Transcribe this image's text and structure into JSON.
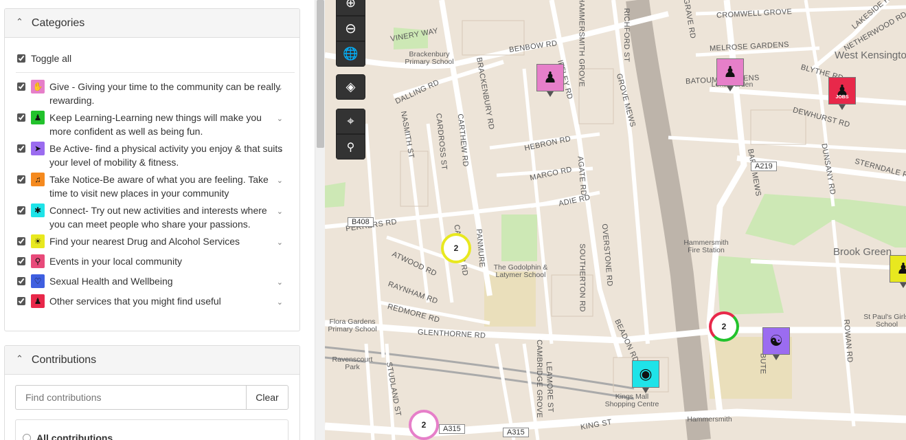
{
  "categories_panel": {
    "title": "Categories",
    "toggle_all_label": "Toggle all",
    "items": [
      {
        "icon": "hands-heart-icon",
        "color": "#e67fc9",
        "label": "Give - Giving your time to the community can be really rewarding.",
        "has_dropdown": true
      },
      {
        "icon": "people-group-icon",
        "color": "#22c22c",
        "label": "Keep Learning-Learning new things will make you more confident as well as being fun.",
        "has_dropdown": true
      },
      {
        "icon": "runner-icon",
        "color": "#9b6cf0",
        "label": "Be Active- find a physical activity you enjoy & that suits your level of mobility & fitness.",
        "has_dropdown": true
      },
      {
        "icon": "megaphone-icon",
        "color": "#f58a1f",
        "label": "Take Notice-Be aware of what you are feeling. Take time to visit new places in your community",
        "has_dropdown": true
      },
      {
        "icon": "puzzle-icon",
        "color": "#1fe3e8",
        "label": "Connect- Try out new activities and interests where you can meet people who share your passions.",
        "has_dropdown": true
      },
      {
        "icon": "sun-icon",
        "color": "#e8e81f",
        "label": "Find your nearest Drug and Alcohol Services",
        "has_dropdown": true
      },
      {
        "icon": "magnifier-icon",
        "color": "#e84a7a",
        "label": "Events in your local community",
        "has_dropdown": false
      },
      {
        "icon": "heart-icon",
        "color": "#3f5fe0",
        "label": "Sexual Health and Wellbeing",
        "has_dropdown": true
      },
      {
        "icon": "people-pair-icon",
        "color": "#e8284a",
        "label": "Other services that you might find useful",
        "has_dropdown": true
      }
    ]
  },
  "contributions_panel": {
    "title": "Contributions",
    "search_placeholder": "Find contributions",
    "clear_label": "Clear",
    "filter_label": "All contributions"
  },
  "map": {
    "street_labels": [
      "CROMWELL GROVE",
      "MELROSE GARDENS",
      "BATOUM GARDENS",
      "BLYTHE RD",
      "DEWHURST RD",
      "NETHERWOOD RD",
      "LAKESIDE RD",
      "BENBOW RD",
      "HAMMERSMITH GROVE",
      "RICHFORD ST",
      "DALLING RD",
      "BRACKENBURY RD",
      "IFFLEY RD",
      "HEBRON RD",
      "MARCO RD",
      "ADIE RD",
      "AGATE RD",
      "GROVE MEWS",
      "BARB MEWS",
      "DUNSANY RD",
      "STERNDALE RD",
      "PERRERS RD",
      "ATWOOD RD",
      "RAYNHAM RD",
      "REDMORE RD",
      "GLENTHORNE RD",
      "CATHNOR RD",
      "SOUTHERTON RD",
      "OVERSTONE RD",
      "BEADON RD",
      "BUTE",
      "ROWAN RD",
      "KING ST",
      "CAMBRIDGE GROVE",
      "LEAMORE ST",
      "STUDLAND ST",
      "NASMITH ST",
      "CARDROSS ST",
      "CARTHEW RD",
      "PANMURE",
      "VINERY WAY",
      "SULGRAVE RD"
    ],
    "place_labels": [
      "West Kensington Park",
      "Brook Green",
      "Hammersmith"
    ],
    "poi_labels": [
      "Brackenbury Primary School",
      "Loris Garden",
      "Hammersmith Fire Station",
      "The Godolphin & Latymer School",
      "Flora Gardens Primary School",
      "Kings Mall Shopping Centre",
      "St Paul's Girls' School",
      "Ravenscourt Park"
    ],
    "road_signs": [
      "A219",
      "B408",
      "A315",
      "A315"
    ],
    "clusters": [
      {
        "count": "2",
        "color": "#e8e81f"
      },
      {
        "count": "2",
        "color": "#e8284a"
      },
      {
        "count": "2",
        "color": "#e67fc9"
      }
    ],
    "markers": [
      {
        "icon": "people-group-icon",
        "color": "#e67fc9"
      },
      {
        "icon": "people-group-icon",
        "color": "#e67fc9"
      },
      {
        "icon": "jobs-icon",
        "color": "#e8284a",
        "text": "JOBS"
      },
      {
        "icon": "meditation-icon",
        "color": "#9b6cf0"
      },
      {
        "icon": "mask-icon",
        "color": "#1fe3e8"
      },
      {
        "icon": "people-group-icon",
        "color": "#e8e81f"
      }
    ]
  }
}
